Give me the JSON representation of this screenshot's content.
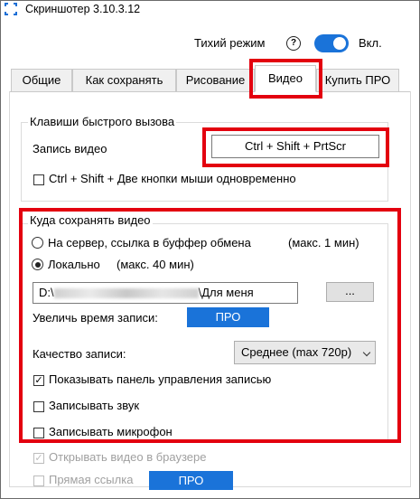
{
  "window": {
    "title": "Скриншотер 3.10.3.12"
  },
  "quiet_mode": {
    "label": "Тихий режим",
    "help_icon": "?",
    "toggle_state": "on",
    "toggle_label": "Вкл."
  },
  "tabs": [
    {
      "label": "Общие",
      "active": false
    },
    {
      "label": "Как сохранять",
      "active": false
    },
    {
      "label": "Рисование",
      "active": false
    },
    {
      "label": "Видео",
      "active": true
    },
    {
      "label": "Купить ПРО",
      "active": false
    }
  ],
  "hotkeys": {
    "group_title": "Клавиши быстрого вызова",
    "record_label": "Запись видео",
    "record_value": "Ctrl + Shift + PrtScr",
    "mouse_checkbox_label": "Ctrl + Shift + Две кнопки мыши одновременно",
    "mouse_checkbox_checked": false
  },
  "save": {
    "group_title": "Куда сохранять видео",
    "server_option": "На сервер, ссылка в буффер обмена",
    "server_limit": "(макс. 1 мин)",
    "local_option": "Локально",
    "local_limit": "(макс. 40 мин)",
    "selected": "local",
    "path_prefix": "D:\\",
    "path_suffix": "\\Для меня",
    "browse_button": "...",
    "extend_label": "Увеличь время записи:",
    "pro_button": "ПРО",
    "quality_label": "Качество записи:",
    "quality_value": "Среднее (max 720p)",
    "show_panel_label": "Показывать панель управления записью",
    "show_panel_checked": true,
    "record_sound_label": "Записывать звук",
    "record_sound_checked": false,
    "record_mic_label": "Записывать микрофон",
    "record_mic_checked": false
  },
  "extra": {
    "open_browser_label": "Открывать видео в браузере",
    "direct_link_label": "Прямая ссылка",
    "pro_button": "ПРО"
  },
  "colors": {
    "accent": "#1a73d9",
    "highlight": "#e3000f"
  }
}
